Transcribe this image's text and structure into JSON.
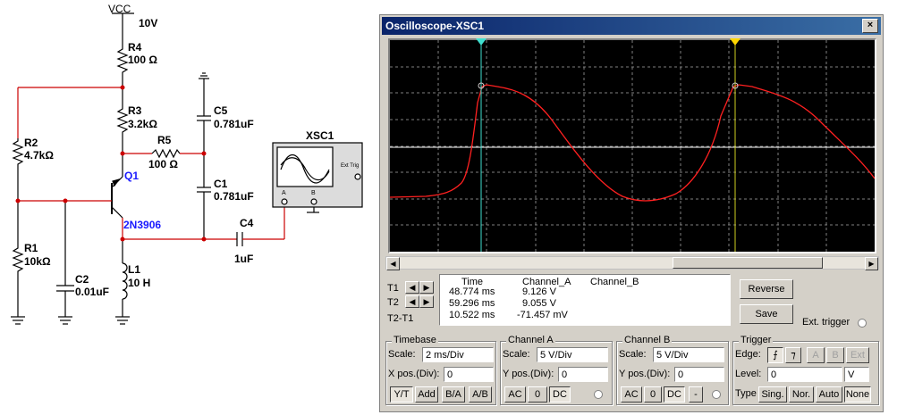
{
  "schematic": {
    "vcc_label": "VCC",
    "vcc_value": "10V",
    "r4": {
      "name": "R4",
      "value": "100 Ω"
    },
    "r3": {
      "name": "R3",
      "value": "3.2kΩ"
    },
    "r5": {
      "name": "R5",
      "value": "100 Ω"
    },
    "r2": {
      "name": "R2",
      "value": "4.7kΩ"
    },
    "r1": {
      "name": "R1",
      "value": "10kΩ"
    },
    "c5": {
      "name": "C5",
      "value": "0.781uF"
    },
    "c1": {
      "name": "C1",
      "value": "0.781uF"
    },
    "c2": {
      "name": "C2",
      "value": "0.01uF"
    },
    "c4": {
      "name": "C4",
      "value": "1uF"
    },
    "l1": {
      "name": "L1",
      "value": "10 H"
    },
    "q1": {
      "name": "Q1",
      "model": "2N3906"
    },
    "xsc1": {
      "name": "XSC1",
      "ext_trig": "Ext Trig",
      "a": "A",
      "b": "B"
    }
  },
  "window": {
    "title": "Oscilloscope-XSC1",
    "close": "×"
  },
  "cursors": {
    "t1_marker": "1",
    "t2_marker": "2",
    "t1_color": "#40e0d0",
    "t2_color": "#ffd700"
  },
  "trace": {
    "channel_a_color": "#ff2020",
    "channel_b_color": "#ffffff"
  },
  "readout": {
    "labels": {
      "t1": "T1",
      "t2": "T2",
      "t2t1": "T2-T1"
    },
    "headers": {
      "time": "Time",
      "channel_a": "Channel_A",
      "channel_b": "Channel_B"
    },
    "rows": [
      {
        "time": "48.774 ms",
        "channel_a": "9.126 V",
        "channel_b": ""
      },
      {
        "time": "59.296 ms",
        "channel_a": "9.055 V",
        "channel_b": ""
      },
      {
        "time": "10.522 ms",
        "channel_a": "-71.457 mV",
        "channel_b": ""
      }
    ]
  },
  "buttons": {
    "reverse": "Reverse",
    "save": "Save",
    "ext_trigger": "Ext. trigger"
  },
  "timebase": {
    "title": "Timebase",
    "scale_label": "Scale:",
    "scale_value": "2 ms/Div",
    "xpos_label": "X pos.(Div):",
    "xpos_value": "0",
    "modes": [
      "Y/T",
      "Add",
      "B/A",
      "A/B"
    ]
  },
  "channel_a": {
    "title": "Channel A",
    "scale_label": "Scale:",
    "scale_value": "5  V/Div",
    "ypos_label": "Y pos.(Div):",
    "ypos_value": "0",
    "coupling": [
      "AC",
      "0",
      "DC"
    ]
  },
  "channel_b": {
    "title": "Channel B",
    "scale_label": "Scale:",
    "scale_value": "5  V/Div",
    "ypos_label": "Y pos.(Div):",
    "ypos_value": "0",
    "coupling": [
      "AC",
      "0",
      "DC",
      "-"
    ]
  },
  "trigger": {
    "title": "Trigger",
    "edge_label": "Edge:",
    "edge_rise": "⨍",
    "edge_fall": "⁊",
    "sources": [
      "A",
      "B",
      "Ext"
    ],
    "level_label": "Level:",
    "level_value": "0",
    "level_unit": "V",
    "type_label": "Type",
    "types": [
      "Sing.",
      "Nor.",
      "Auto",
      "None"
    ]
  }
}
